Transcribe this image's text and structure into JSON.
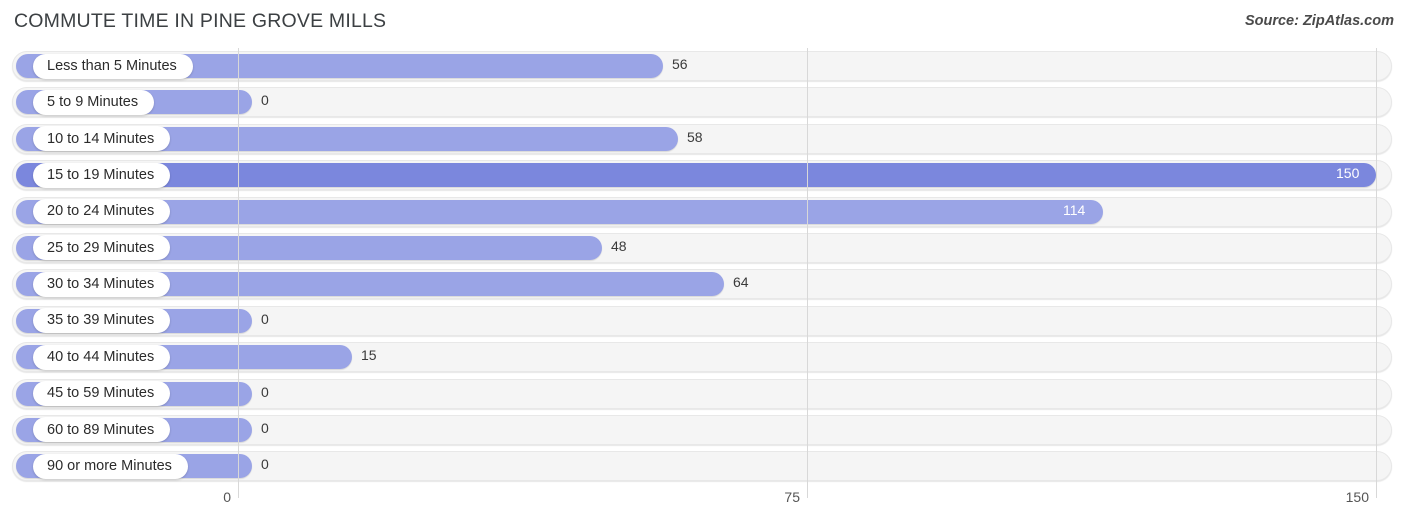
{
  "header": {
    "title": "COMMUTE TIME IN PINE GROVE MILLS",
    "source": "Source: ZipAtlas.com"
  },
  "chart_data": {
    "type": "bar",
    "orientation": "horizontal",
    "title": "COMMUTE TIME IN PINE GROVE MILLS",
    "xlabel": "",
    "ylabel": "",
    "xlim": [
      0,
      150
    ],
    "grid": true,
    "legend": false,
    "xticks": [
      "0",
      "75",
      "150"
    ],
    "xtick_values": [
      0,
      75,
      150
    ],
    "categories": [
      "Less than 5 Minutes",
      "5 to 9 Minutes",
      "10 to 14 Minutes",
      "15 to 19 Minutes",
      "20 to 24 Minutes",
      "25 to 29 Minutes",
      "30 to 34 Minutes",
      "35 to 39 Minutes",
      "40 to 44 Minutes",
      "45 to 59 Minutes",
      "60 to 89 Minutes",
      "90 or more Minutes"
    ],
    "values": [
      56,
      0,
      58,
      150,
      114,
      48,
      64,
      0,
      15,
      0,
      0,
      0
    ],
    "value_labels": [
      "56",
      "0",
      "58",
      "150",
      "114",
      "48",
      "64",
      "0",
      "15",
      "0",
      "0",
      "0"
    ],
    "highlighted_index": 3,
    "colors": {
      "bar": "#9aa4e6",
      "bar_highlight": "#7b87dd",
      "track": "#f5f5f5",
      "gridline": "#d8d8d8",
      "label_pill": "#ffffff",
      "value_text": "#3a3a3a",
      "value_text_inside": "#ffffff"
    }
  }
}
